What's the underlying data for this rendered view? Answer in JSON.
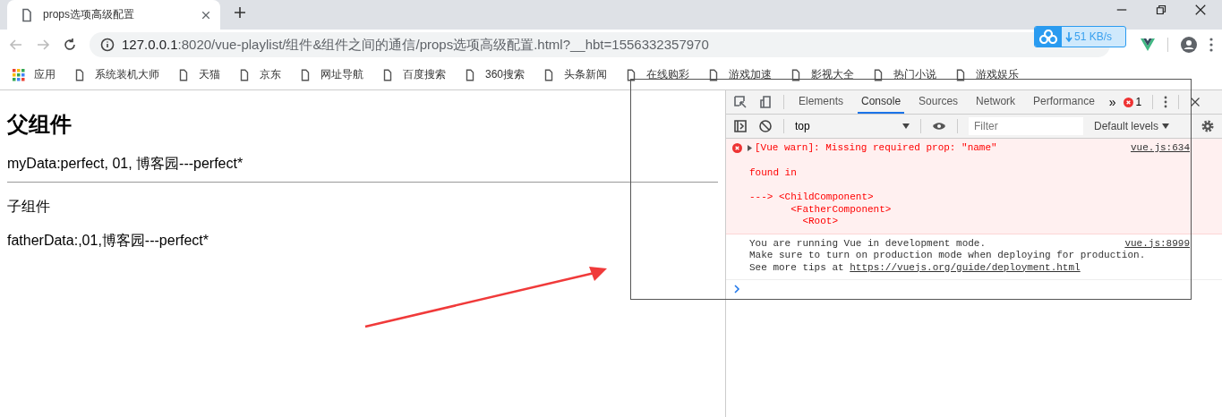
{
  "browser": {
    "tab": {
      "title": "props选项高级配置",
      "selected": true
    },
    "address": {
      "host": "127.0.0.1",
      "path": ":8020/vue-playlist/组件&组件之间的通信/props选项高级配置.html?__hbt=1556332357970"
    },
    "speed_widget": {
      "reading": "51 KB/s"
    },
    "bookmarks": [
      {
        "kind": "apps",
        "label": "应用"
      },
      {
        "kind": "page",
        "label": "系统装机大师"
      },
      {
        "kind": "page",
        "label": "天猫"
      },
      {
        "kind": "page",
        "label": "京东"
      },
      {
        "kind": "page",
        "label": "网址导航"
      },
      {
        "kind": "page",
        "label": "百度搜索"
      },
      {
        "kind": "page",
        "label": "360搜索"
      },
      {
        "kind": "page",
        "label": "头条新闻"
      },
      {
        "kind": "page",
        "label": "在线购彩"
      },
      {
        "kind": "page",
        "label": "游戏加速"
      },
      {
        "kind": "page",
        "label": "影视大全"
      },
      {
        "kind": "page",
        "label": "热门小说"
      },
      {
        "kind": "page",
        "label": "游戏娱乐"
      }
    ]
  },
  "page": {
    "heading": "父组件",
    "my_data": "myData:perfect, 01, 博客园---perfect*",
    "child_heading": "子组件",
    "father_data": "fatherData:,01,博客园---perfect*"
  },
  "devtools": {
    "tabs": [
      {
        "label": "Elements",
        "selected": false
      },
      {
        "label": "Console",
        "selected": true
      },
      {
        "label": "Sources",
        "selected": false
      },
      {
        "label": "Network",
        "selected": false
      },
      {
        "label": "Performance",
        "selected": false
      }
    ],
    "more": "»",
    "error_count": "1",
    "context": "top",
    "filter_placeholder": "Filter",
    "levels": "Default levels",
    "messages": [
      {
        "kind": "error",
        "text": "[Vue warn]: Missing required prop: \"name\"",
        "source": "vue.js:634",
        "found_in": "found in",
        "trace": [
          "---> <ChildComponent>",
          "       <FatherComponent>",
          "         <Root>"
        ]
      },
      {
        "kind": "info",
        "source": "vue.js:8999",
        "lines": [
          "You are running Vue in development mode.",
          "Make sure to turn on production mode when deploying for production."
        ],
        "tip": "See more tips at",
        "link": "https://vuejs.org/guide/deployment.html"
      }
    ]
  }
}
